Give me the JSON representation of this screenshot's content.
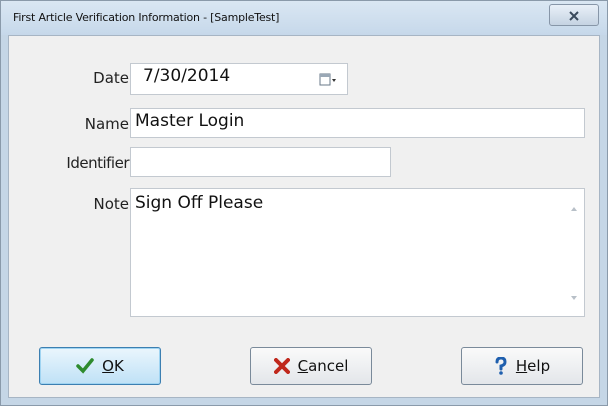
{
  "window": {
    "title": "First Article Verification Information - [SampleTest]",
    "close_glyph": "x"
  },
  "form": {
    "date": {
      "label": "Date",
      "value": "7/30/2014"
    },
    "name": {
      "label": "Name",
      "value": "Master Login"
    },
    "identifier": {
      "label": "Identifier",
      "value": ""
    },
    "note": {
      "label": "Note",
      "value": "Sign Off Please"
    }
  },
  "buttons": {
    "ok": {
      "mnemonic": "O",
      "rest": "K",
      "icon": "checkmark-icon",
      "color": "#2e8b2e"
    },
    "cancel": {
      "mnemonic": "C",
      "rest": "ancel",
      "icon": "x-icon",
      "color": "#c0281c"
    },
    "help": {
      "mnemonic": "H",
      "rest": "elp",
      "icon": "question-icon",
      "color": "#1f5fae"
    }
  },
  "colors": {
    "title_bar": "#c6d8ea",
    "dialog_bg": "#f0f0f0",
    "default_button": "#bfe1f6"
  }
}
